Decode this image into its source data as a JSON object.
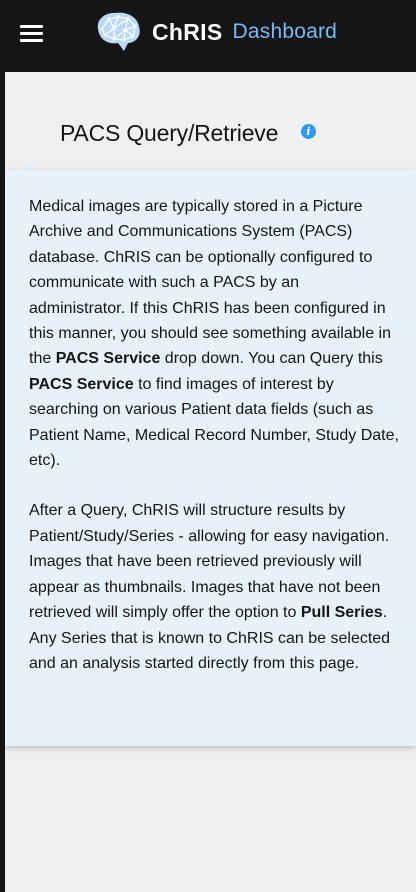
{
  "header": {
    "menu_icon": "hamburger-menu-icon",
    "logo_icon": "chris-brain-logo-icon",
    "brand_name": "ChRIS",
    "brand_subtitle": "Dashboard"
  },
  "page": {
    "title": "PACS Query/Retrieve",
    "info_icon": "info-circle-icon",
    "info_glyph": "i"
  },
  "popover": {
    "paragraph1": {
      "part1": "Medical images are typically stored in a Picture Archive and Communications System (PACS) database. ChRIS can be optionally configured to communicate with such a PACS by an administrator. If this ChRIS has been configured in this manner, you should see something available in the ",
      "bold1": "PACS Service",
      "part2": " drop down. You can Query this ",
      "bold2": "PACS Service",
      "part3": " to find images of interest by searching on various Patient data fields (such as Patient Name, Medical Record Number, Study Date, etc)."
    },
    "paragraph2": {
      "part1": "After a Query, ChRIS will structure results by Patient/Study/Series - allowing for easy navigation. Images that have been retrieved previously will appear as thumbnails. Images that have not been retrieved will simply offer the option to ",
      "bold1": "Pull Series",
      "part2": ". Any Series that is known to ChRIS can be selected and an analysis started directly from this page."
    }
  },
  "colors": {
    "header_bg": "#151515",
    "page_bg": "#f0f0f0",
    "popover_bg": "#e7f1fa",
    "accent_blue": "#2b9af3",
    "brand_subtitle": "#73bcf7"
  }
}
